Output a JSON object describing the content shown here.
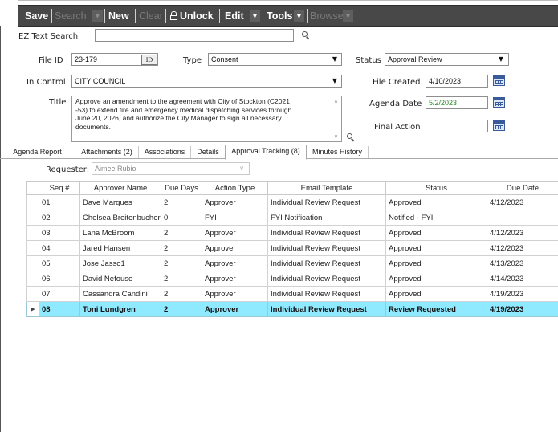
{
  "toolbar": {
    "save": "Save",
    "search": "Search",
    "new": "New",
    "clear": "Clear",
    "unlock": "Unlock",
    "edit": "Edit",
    "tools": "Tools",
    "browse": "Browse"
  },
  "ez_search": {
    "label": "EZ Text Search",
    "value": ""
  },
  "form": {
    "file_id_label": "File ID",
    "file_id": "23-179",
    "id_button": "ID",
    "type_label": "Type",
    "type_value": "Consent",
    "status_label": "Status",
    "status_value": "Approval Review",
    "in_control_label": "In Control",
    "in_control_value": "CITY COUNCIL",
    "file_created_label": "File Created",
    "file_created": "4/10/2023",
    "agenda_date_label": "Agenda Date",
    "agenda_date": "5/2/2023",
    "final_action_label": "Final Action",
    "final_action": "",
    "title_label": "Title",
    "title_lines": [
      "Approve an amendment to the agreement with City of Stockton (C2021",
      "-53) to extend fire and emergency medical dispatching services through",
      "June 20, 2026, and authorize the City Manager to sign all necessary",
      "documents."
    ]
  },
  "tabs": [
    "Agenda Report",
    "Attachments (2)",
    "Associations",
    "Details",
    "Approval Tracking (8)",
    "Minutes History"
  ],
  "requester": {
    "label": "Requester:",
    "value": "Aimee Rubio"
  },
  "grid": {
    "columns": [
      "Seq #",
      "Approver Name",
      "Due Days",
      "Action Type",
      "Email Template",
      "Status",
      "Due Date"
    ],
    "rows": [
      [
        "01",
        "Dave Marques",
        "2",
        "Approver",
        "Individual Review Request",
        "Approved",
        "4/12/2023"
      ],
      [
        "02",
        "Chelsea Breitenbucher",
        "0",
        "FYI",
        "FYI Notification",
        "Notified - FYI",
        ""
      ],
      [
        "03",
        "Lana McBroom",
        "2",
        "Approver",
        "Individual Review Request",
        "Approved",
        "4/12/2023"
      ],
      [
        "04",
        "Jared Hansen",
        "2",
        "Approver",
        "Individual Review Request",
        "Approved",
        "4/12/2023"
      ],
      [
        "05",
        "Jose Jasso1",
        "2",
        "Approver",
        "Individual Review Request",
        "Approved",
        "4/13/2023"
      ],
      [
        "06",
        "David Nefouse",
        "2",
        "Approver",
        "Individual Review Request",
        "Approved",
        "4/14/2023"
      ],
      [
        "07",
        "Cassandra Candini",
        "2",
        "Approver",
        "Individual Review Request",
        "Approved",
        "4/19/2023"
      ],
      [
        "08",
        "Toni Lundgren",
        "2",
        "Approver",
        "Individual Review Request",
        "Review Requested",
        "4/19/2023"
      ]
    ],
    "selected_row_indicator": "▶"
  },
  "colors": {
    "toolbar_bg": "#484848",
    "selected_row": "#8fe9ff",
    "agenda_date_text": "#2a8a2a",
    "calendar": "#3a5b9a"
  },
  "icons": [
    "dropdown-arrow-icon",
    "lock-icon",
    "magnifier-icon",
    "calendar-icon",
    "row-pointer-icon"
  ]
}
